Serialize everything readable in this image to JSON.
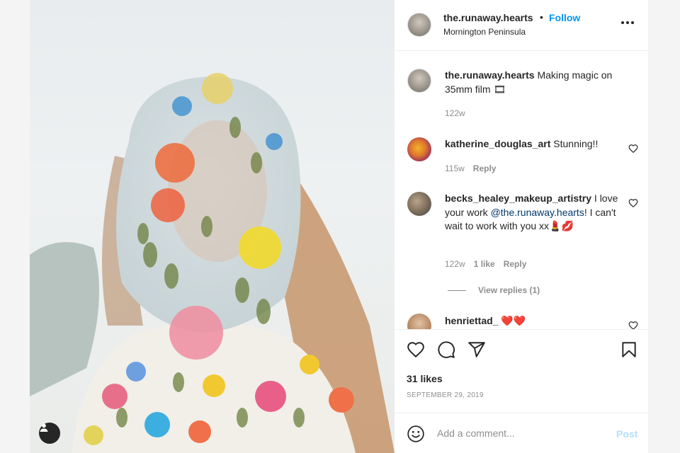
{
  "post": {
    "username": "the.runaway.hearts",
    "follow_label": "Follow",
    "separator": "•",
    "location": "Mornington Peninsula",
    "likes": "31 likes",
    "date": "SEPTEMBER 29, 2019"
  },
  "caption": {
    "username": "the.runaway.hearts",
    "text": " Making magic on 35mm film 🎞",
    "time": "122w"
  },
  "comments": [
    {
      "username": "katherine_douglas_art",
      "text": " Stunning!!",
      "time": "115w",
      "reply": "Reply"
    },
    {
      "username": "becks_healey_makeup_artistry",
      "text_before": " I love your work ",
      "mention": "@the.runaway.hearts",
      "text_after": "! I can't wait to work with you xx💄💋",
      "time": "122w",
      "likes": "1 like",
      "reply": "Reply",
      "view_replies": "View replies (1)"
    },
    {
      "username": "henriettad_",
      "text": " ❤️❤️"
    }
  ],
  "composer": {
    "placeholder": "Add a comment...",
    "post_label": "Post"
  },
  "icons": {
    "more": "more-icon",
    "like": "heart-icon",
    "comment": "comment-icon",
    "share": "share-icon",
    "save": "bookmark-icon",
    "emoji": "emoji-icon",
    "tag": "user-tag-icon"
  },
  "colors": {
    "accent": "#0095f6",
    "post_disabled": "#b2dffc",
    "text": "#262626",
    "muted": "#8e8e8e"
  }
}
